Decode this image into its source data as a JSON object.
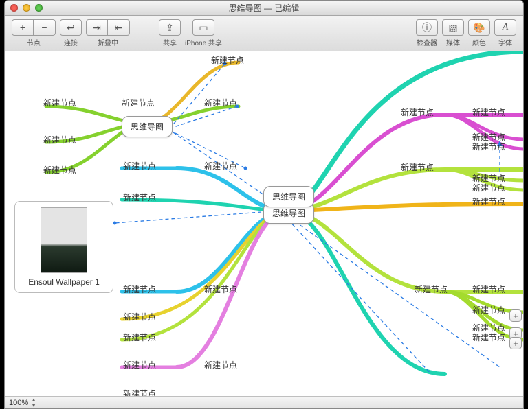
{
  "window": {
    "title": "思维导图 — 已编辑"
  },
  "toolbar": {
    "node": {
      "label": "节点",
      "plus": "+",
      "minus": "−"
    },
    "link": {
      "label": "连接",
      "glyph": "↩"
    },
    "fold": {
      "label": "折叠中",
      "in": "⇥",
      "out": "⇤"
    },
    "share": {
      "label": "共享",
      "glyph": "⇪"
    },
    "iphone": {
      "label": "iPhone 共享",
      "glyph": "▭"
    },
    "inspect": {
      "label": "检查器",
      "glyph": "ⓘ"
    },
    "media": {
      "label": "媒体",
      "glyph": "▧"
    },
    "color": {
      "label": "颜色",
      "glyph": "🎨"
    },
    "font": {
      "label": "字体",
      "glyph": "A"
    }
  },
  "center": {
    "label": "思维导图"
  },
  "subroot": {
    "label": "思维导图"
  },
  "media": {
    "caption": "Ensoul Wallpaper 1"
  },
  "node_label": "新建节点",
  "plus": "+",
  "zoom": {
    "value": "100%"
  }
}
